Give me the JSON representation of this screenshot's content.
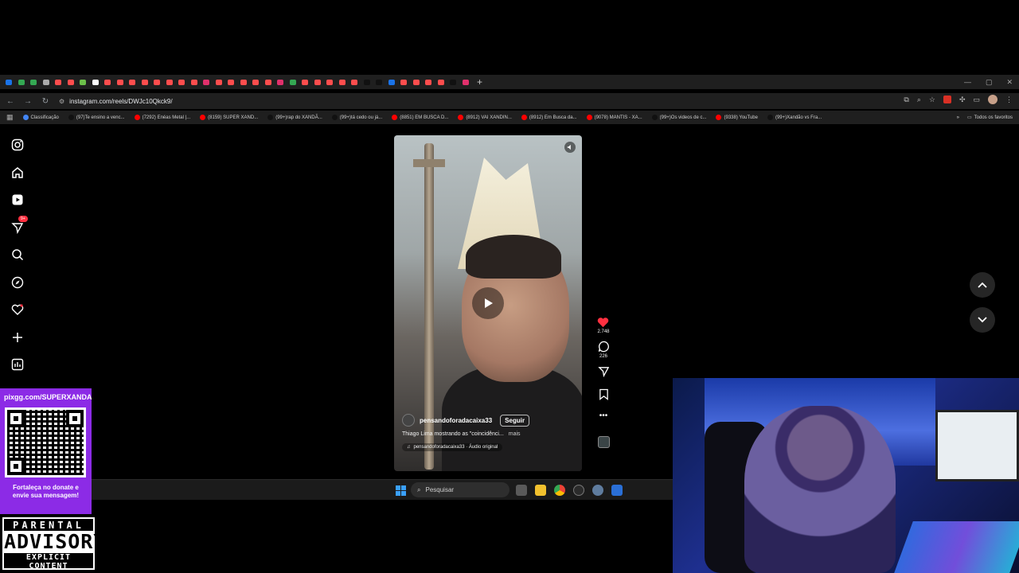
{
  "browser": {
    "tab_colors": [
      "#1a73e8",
      "#34a853",
      "#34a853",
      "#aaaaaa",
      "#ff4d4d",
      "#ff4d4d",
      "#6cc04a",
      "#ffffff",
      "#ff4d4d",
      "#ff4d4d",
      "#ff4d4d",
      "#ff4d4d",
      "#ff4d4d",
      "#ff4d4d",
      "#ff4d4d",
      "#ff4d4d",
      "#e1306c",
      "#ff4d4d",
      "#ff4d4d",
      "#ff4d4d",
      "#ff4d4d",
      "#ff4d4d",
      "#e1306c",
      "#34a853",
      "#ff4d4d",
      "#ff4d4d",
      "#ff4d4d",
      "#ff4d4d",
      "#ff4d4d",
      "#111111",
      "#111111",
      "#1a73e8",
      "#ff4d4d",
      "#ff4d4d",
      "#ff4d4d",
      "#ff4d4d",
      "#111111",
      "#e1306c"
    ],
    "new_tab": "+",
    "url": "instagram.com/reels/DWJc10Qkck9/",
    "bookmarks": [
      {
        "label": "Classificação",
        "color": "#4285f4"
      },
      {
        "label": "(97)Te ensino a venc...",
        "color": "#111111"
      },
      {
        "label": "(7292) Enéas Metal |...",
        "color": "#ff0000"
      },
      {
        "label": "(8159) SUPER XAND...",
        "color": "#ff0000"
      },
      {
        "label": "(99+)rap do XANDÃ...",
        "color": "#111111"
      },
      {
        "label": "(99+)tá cedo ou já...",
        "color": "#111111"
      },
      {
        "label": "(8851) EM BUSCA D...",
        "color": "#ff0000"
      },
      {
        "label": "(8912) VAI XANDIN...",
        "color": "#ff0000"
      },
      {
        "label": "(8912) Em Busca da...",
        "color": "#ff0000"
      },
      {
        "label": "(9078) MANTIS - XA...",
        "color": "#ff0000"
      },
      {
        "label": "(99+)Os videos de c...",
        "color": "#111111"
      },
      {
        "label": "(9338) YouTube",
        "color": "#ff0000"
      },
      {
        "label": "(99+)Xandão vs Fra...",
        "color": "#111111"
      }
    ],
    "all_bookmarks": "Todos os favoritos"
  },
  "instagram": {
    "notifications_badge": "9+",
    "reel": {
      "author": "pensandoforadacaixa33",
      "follow_label": "Seguir",
      "caption": "Thiago Lima mostrando as \"coincidênci...",
      "more": "mais",
      "audio": "pensandoforadacaixa33 · Áudio original",
      "likes": "2.748",
      "comments": "226"
    }
  },
  "taskbar": {
    "search_placeholder": "Pesquisar"
  },
  "overlay": {
    "donate_url": "pixgg.com/SUPERXANDA",
    "donate_message_1": "Fortaleça no donate e",
    "donate_message_2": "envie sua mensagem!",
    "advisory_line1": "PARENTAL",
    "advisory_line2": "ADVISORY",
    "advisory_line3": "EXPLICIT CONTENT"
  }
}
